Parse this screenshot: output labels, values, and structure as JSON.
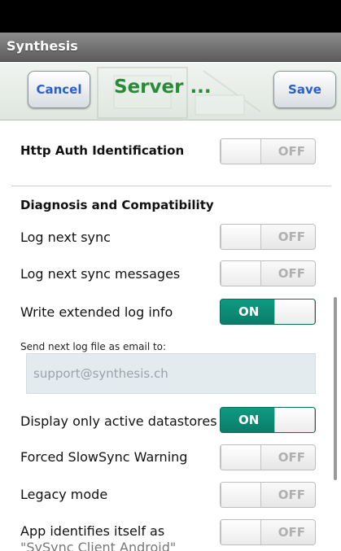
{
  "app": {
    "title": "Synthesis"
  },
  "nav": {
    "cancel_label": "Cancel",
    "title": "Server ...",
    "save_label": "Save"
  },
  "settings": {
    "http_auth": {
      "label": "Http Auth Identification",
      "state": "OFF"
    },
    "section_diagnosis": "Diagnosis and Compatibility",
    "log_next_sync": {
      "label": "Log next sync",
      "state": "OFF"
    },
    "log_next_sync_messages": {
      "label": "Log next sync messages",
      "state": "OFF"
    },
    "write_extended_log": {
      "label": "Write extended log info",
      "state": "ON"
    },
    "send_log_email": {
      "label": "Send next log file as email to:",
      "placeholder": "support@synthesis.ch"
    },
    "display_active_datastores": {
      "label": "Display only active datastores",
      "state": "ON"
    },
    "forced_slowsync": {
      "label": "Forced SlowSync Warning",
      "state": "OFF"
    },
    "legacy_mode": {
      "label": "Legacy mode",
      "state": "OFF"
    },
    "app_identifies": {
      "label_line1": "App identifies itself as",
      "label_line2": "\"SySync Client Android\"",
      "state": "OFF"
    }
  },
  "colors": {
    "accent_on": "#0e9a82",
    "nav_title": "#2a8a3a",
    "button_text": "#2a5fd0"
  }
}
